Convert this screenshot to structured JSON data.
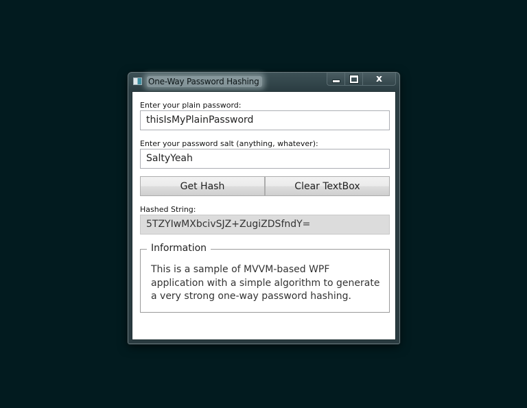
{
  "window": {
    "title": "One-Way Password Hashing",
    "app_icon": "wpf-window-icon",
    "controls": {
      "minimize_icon": "minimize-icon",
      "maximize_icon": "maximize-icon",
      "close_label": "x"
    }
  },
  "form": {
    "password_label": "Enter your plain password:",
    "password_value": "thisIsMyPlainPassword",
    "salt_label": "Enter your password salt (anything, whatever):",
    "salt_value": "SaltyYeah",
    "get_hash_label": "Get Hash",
    "clear_label": "Clear TextBox",
    "hashed_label": "Hashed String:",
    "hashed_value": "5TZYIwMXbcivSJZ+ZugiZDSfndY="
  },
  "info": {
    "header": "Information",
    "text": "This is a sample of MVVM-based WPF application with a simple algorithm to generate a very strong one-way password hashing."
  },
  "colors": {
    "desktop": "#021b1f",
    "frame": "#2c3e43",
    "readonly_field": "#dcdcdc"
  }
}
